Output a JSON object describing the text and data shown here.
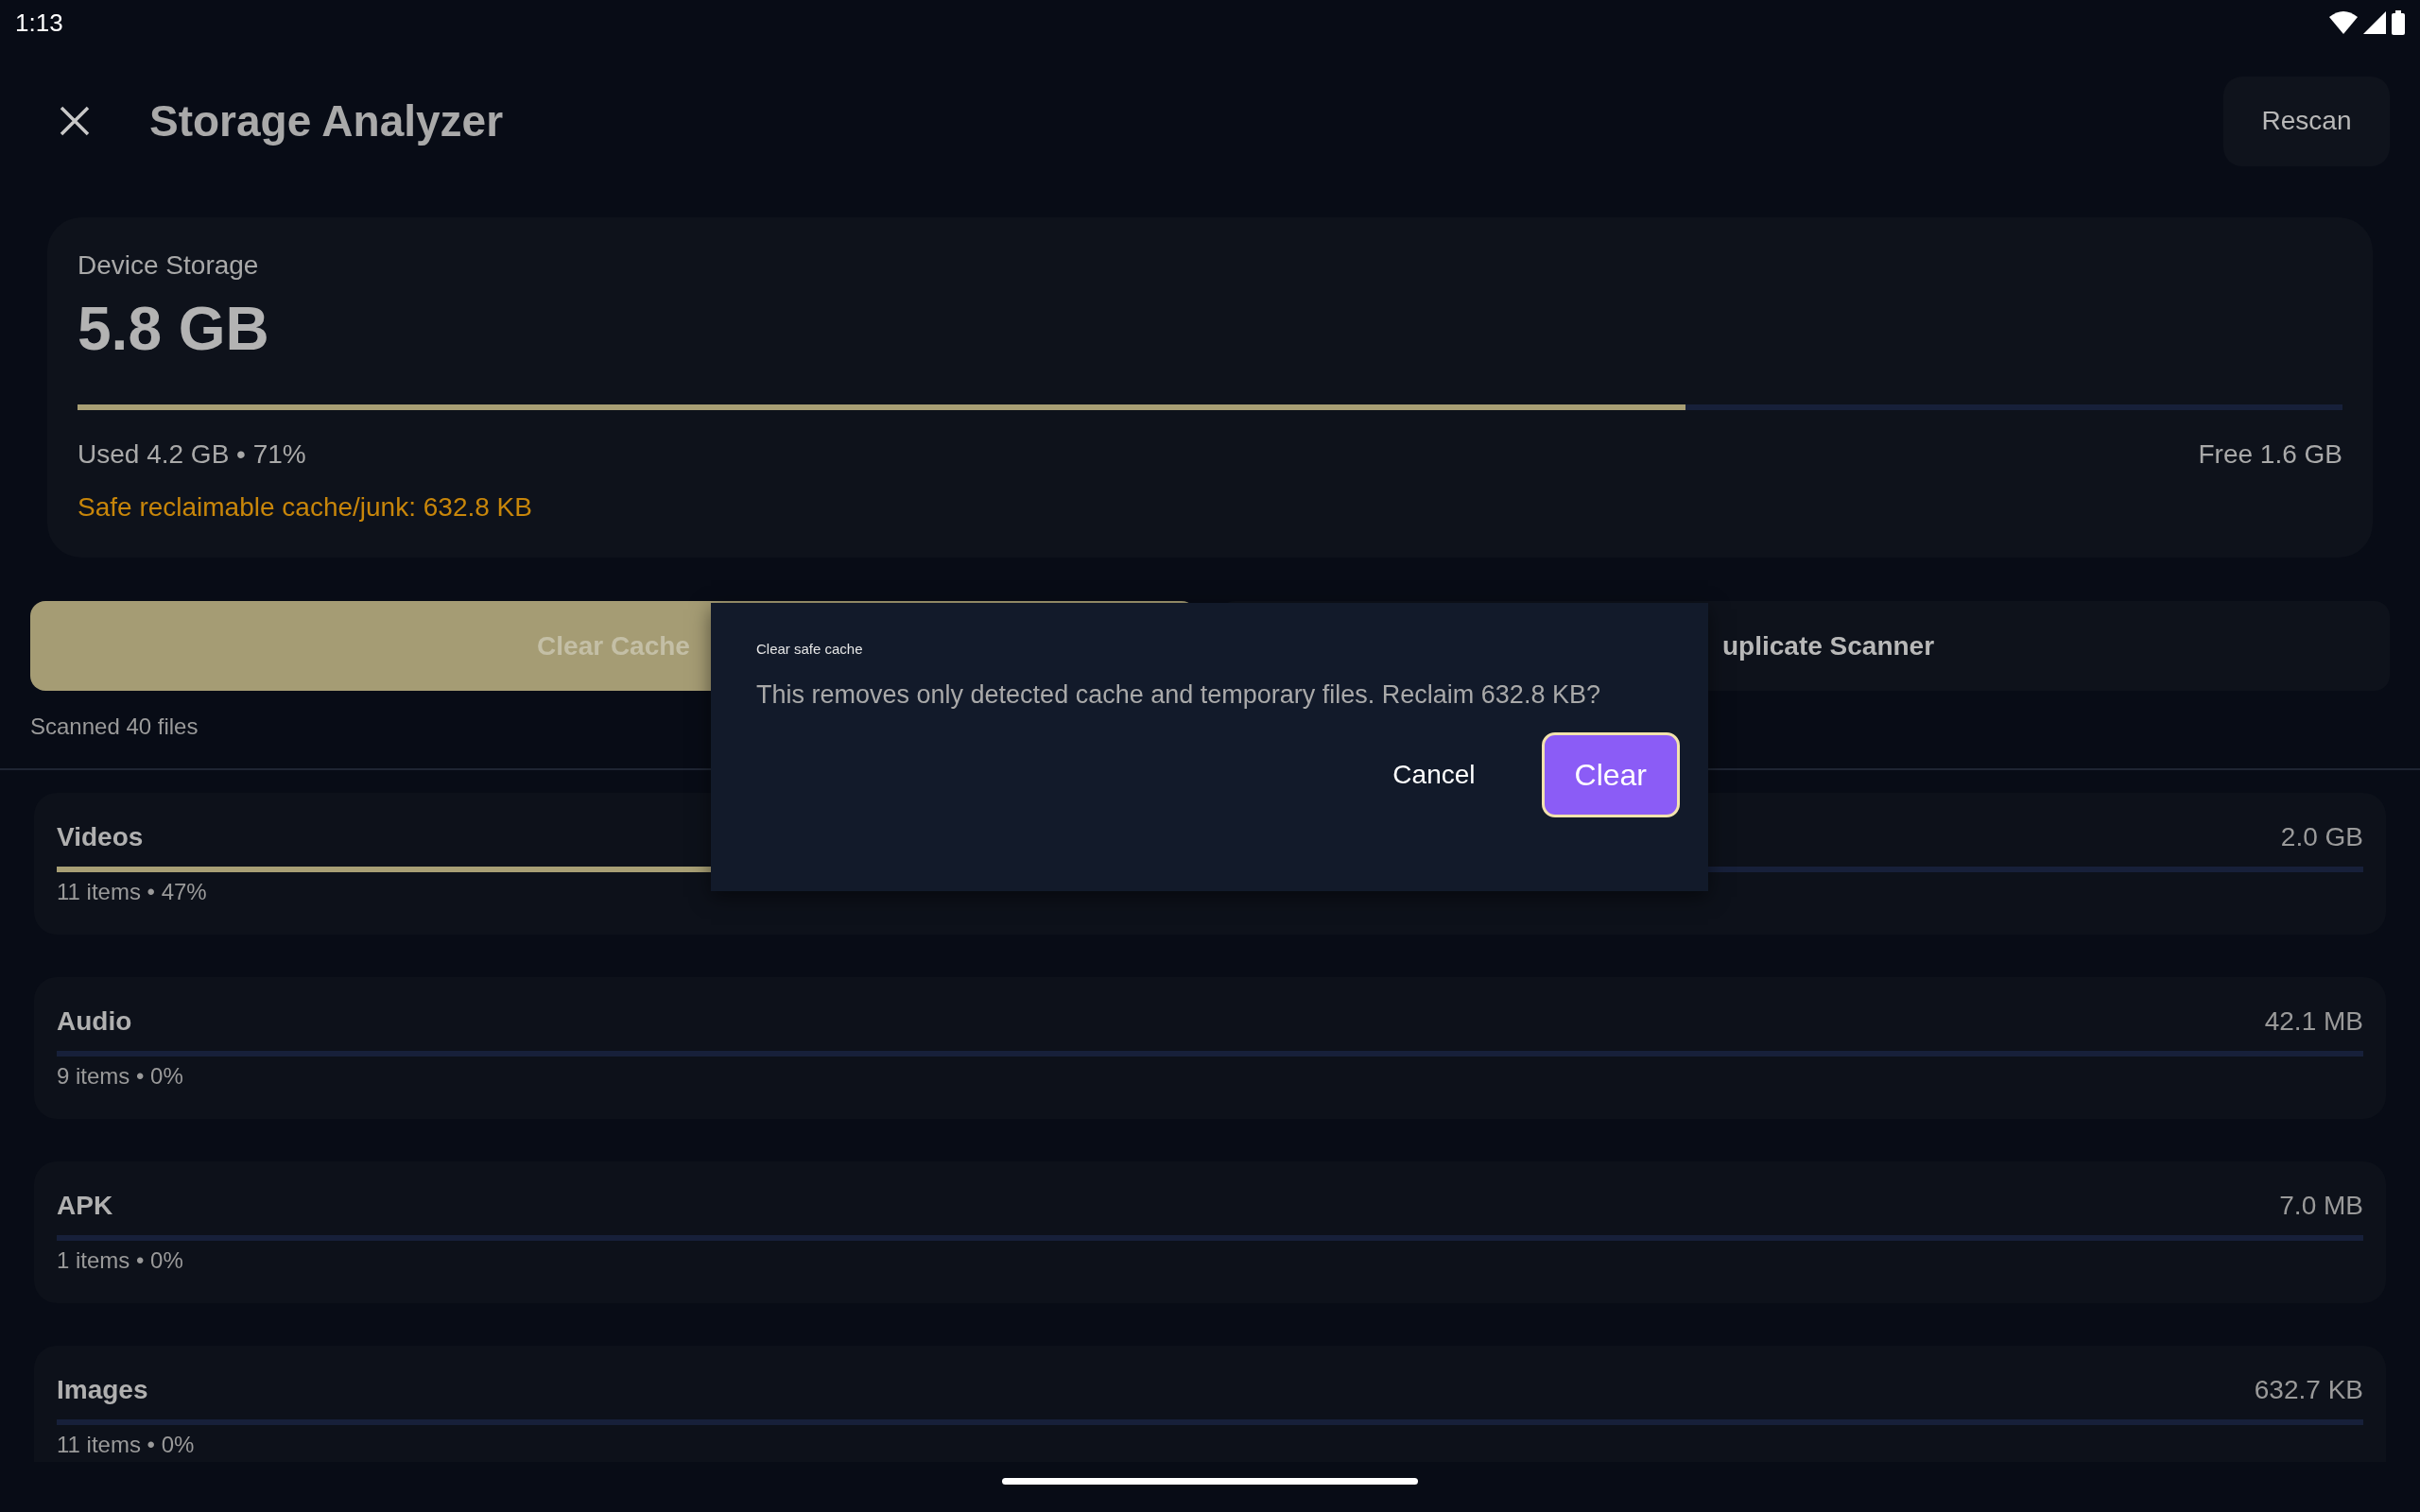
{
  "status_bar": {
    "time": "1:13"
  },
  "header": {
    "title": "Storage Analyzer",
    "action": "Rescan"
  },
  "storage": {
    "label": "Device Storage",
    "total": "5.8 GB",
    "level": 0.71,
    "used": "Used 4.2 GB • 71%",
    "free": "Free 1.6 GB",
    "reclaimable": "Safe reclaimable cache/junk: 632.8 KB"
  },
  "actions": [
    {
      "label": "Clear Cache",
      "kind": "primary"
    },
    {
      "label": "uplicate Scanner",
      "kind": "secondary"
    }
  ],
  "scan_summary": "Scanned 40 files",
  "categories": [
    {
      "name": "Videos",
      "size": "2.0 GB",
      "details": "11 items • 47%",
      "level": 0.47
    },
    {
      "name": "Audio",
      "size": "42.1 MB",
      "details": "9 items • 0%",
      "level": 0
    },
    {
      "name": "APK",
      "size": "7.0 MB",
      "details": "1 items • 0%",
      "level": 0
    },
    {
      "name": "Images",
      "size": "632.7 KB",
      "details": "11 items • 0%",
      "level": 0
    }
  ],
  "dialog": {
    "title": "Clear safe cache",
    "message": "This removes only detected cache and temporary files. Reclaim 632.8 KB?",
    "buttons": [
      {
        "label": "Cancel",
        "kind": "text"
      },
      {
        "label": "Clear",
        "kind": "primary"
      }
    ]
  }
}
